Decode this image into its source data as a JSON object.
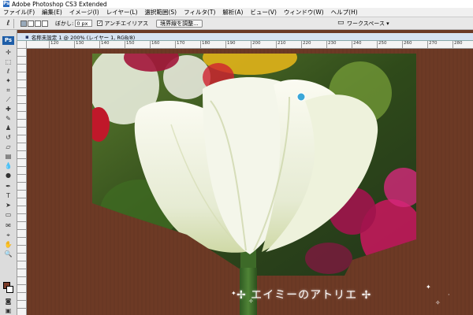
{
  "window": {
    "app_logo": "Ps",
    "title": "Adobe Photoshop CS3 Extended"
  },
  "menu": {
    "items": [
      "ファイル(F)",
      "編集(E)",
      "イメージ(I)",
      "レイヤー(L)",
      "選択範囲(S)",
      "フィルタ(T)",
      "解析(A)",
      "ビュー(V)",
      "ウィンドウ(W)",
      "ヘルプ(H)"
    ]
  },
  "options_bar": {
    "feather_label": "ぼかし:",
    "feather_value": "0 px",
    "antialias_label": "アンチエイリアス",
    "antialias_checked": true,
    "refine_edge_button": "境界線を調整...",
    "workspace_label": "ワークスペース ▾"
  },
  "toolbox": {
    "logo": "Ps",
    "foreground_color": "#7b3b28",
    "background_color": "#ffffff"
  },
  "document": {
    "title": "名称未設定 1 @ 200% (レイヤー 1, RGB/8)",
    "ruler_ticks": [
      "120",
      "130",
      "140",
      "150",
      "160",
      "170",
      "180",
      "190",
      "200",
      "210",
      "220",
      "230",
      "240",
      "250",
      "260",
      "270",
      "280",
      "290"
    ],
    "canvas_color": "#6d3a25"
  },
  "watermark": {
    "text": "✢ エイミーのアトリエ ✢"
  }
}
